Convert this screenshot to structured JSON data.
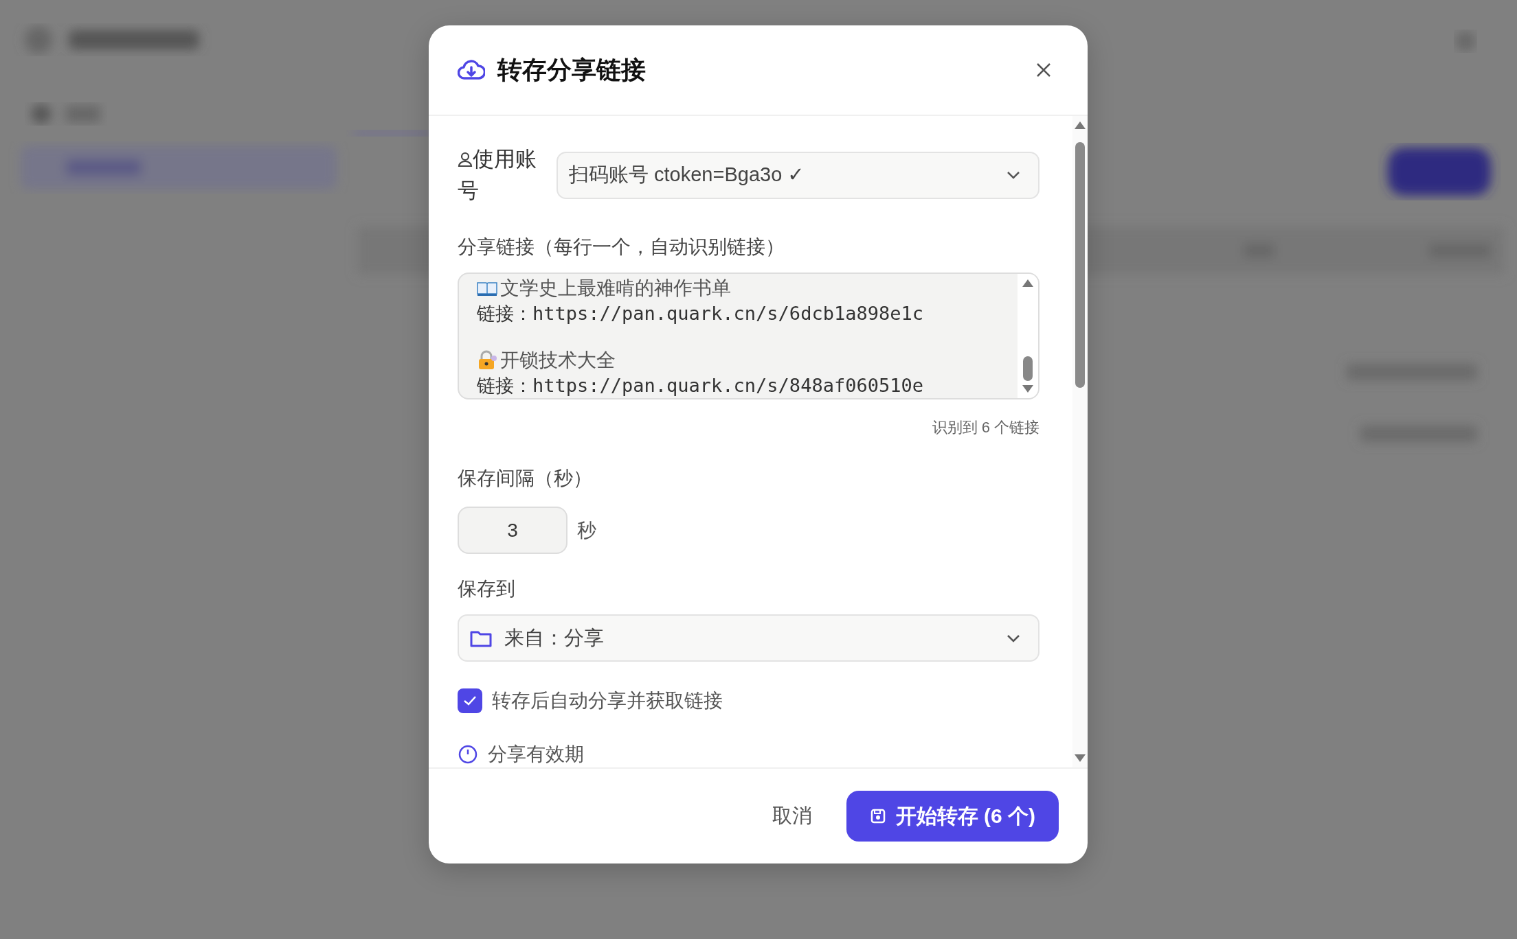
{
  "dialog": {
    "title": "转存分享链接",
    "account": {
      "label": "使用账号",
      "value": "扫码账号 ctoken=Bga3o ✓"
    },
    "links": {
      "label": "分享链接（每行一个，自动识别链接）",
      "lines": [
        {
          "kind": "title",
          "text": "文学史上最难啃的神作书单"
        },
        {
          "kind": "link",
          "text": "链接：https://pan.quark.cn/s/6dcb1a898e1c"
        },
        {
          "kind": "blank"
        },
        {
          "kind": "title",
          "text": "开锁技术大全"
        },
        {
          "kind": "link",
          "text": "链接：https://pan.quark.cn/s/848af060510e"
        }
      ],
      "count": "识别到 6 个链接"
    },
    "interval": {
      "label": "保存间隔（秒）",
      "value": "3",
      "unit": "秒"
    },
    "save_to": {
      "label": "保存到",
      "value": "来自：分享"
    },
    "auto_share": {
      "label": "转存后自动分享并获取链接",
      "checked": true
    },
    "expiry": {
      "label": "分享有效期"
    },
    "buttons": {
      "cancel": "取消",
      "start": "开始转存 (6 个)"
    }
  }
}
